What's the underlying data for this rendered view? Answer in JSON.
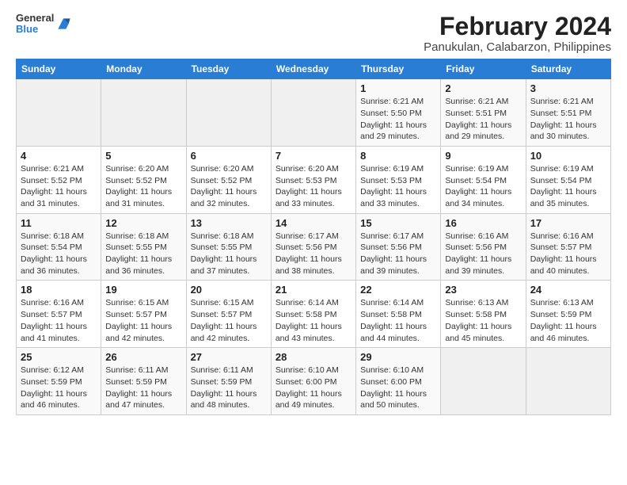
{
  "header": {
    "logo_line1": "General",
    "logo_line2": "Blue",
    "title": "February 2024",
    "subtitle": "Panukulan, Calabarzon, Philippines"
  },
  "weekdays": [
    "Sunday",
    "Monday",
    "Tuesday",
    "Wednesday",
    "Thursday",
    "Friday",
    "Saturday"
  ],
  "weeks": [
    [
      {
        "day": "",
        "info": ""
      },
      {
        "day": "",
        "info": ""
      },
      {
        "day": "",
        "info": ""
      },
      {
        "day": "",
        "info": ""
      },
      {
        "day": "1",
        "info": "Sunrise: 6:21 AM\nSunset: 5:50 PM\nDaylight: 11 hours and 29 minutes."
      },
      {
        "day": "2",
        "info": "Sunrise: 6:21 AM\nSunset: 5:51 PM\nDaylight: 11 hours and 29 minutes."
      },
      {
        "day": "3",
        "info": "Sunrise: 6:21 AM\nSunset: 5:51 PM\nDaylight: 11 hours and 30 minutes."
      }
    ],
    [
      {
        "day": "4",
        "info": "Sunrise: 6:21 AM\nSunset: 5:52 PM\nDaylight: 11 hours and 31 minutes."
      },
      {
        "day": "5",
        "info": "Sunrise: 6:20 AM\nSunset: 5:52 PM\nDaylight: 11 hours and 31 minutes."
      },
      {
        "day": "6",
        "info": "Sunrise: 6:20 AM\nSunset: 5:52 PM\nDaylight: 11 hours and 32 minutes."
      },
      {
        "day": "7",
        "info": "Sunrise: 6:20 AM\nSunset: 5:53 PM\nDaylight: 11 hours and 33 minutes."
      },
      {
        "day": "8",
        "info": "Sunrise: 6:19 AM\nSunset: 5:53 PM\nDaylight: 11 hours and 33 minutes."
      },
      {
        "day": "9",
        "info": "Sunrise: 6:19 AM\nSunset: 5:54 PM\nDaylight: 11 hours and 34 minutes."
      },
      {
        "day": "10",
        "info": "Sunrise: 6:19 AM\nSunset: 5:54 PM\nDaylight: 11 hours and 35 minutes."
      }
    ],
    [
      {
        "day": "11",
        "info": "Sunrise: 6:18 AM\nSunset: 5:54 PM\nDaylight: 11 hours and 36 minutes."
      },
      {
        "day": "12",
        "info": "Sunrise: 6:18 AM\nSunset: 5:55 PM\nDaylight: 11 hours and 36 minutes."
      },
      {
        "day": "13",
        "info": "Sunrise: 6:18 AM\nSunset: 5:55 PM\nDaylight: 11 hours and 37 minutes."
      },
      {
        "day": "14",
        "info": "Sunrise: 6:17 AM\nSunset: 5:56 PM\nDaylight: 11 hours and 38 minutes."
      },
      {
        "day": "15",
        "info": "Sunrise: 6:17 AM\nSunset: 5:56 PM\nDaylight: 11 hours and 39 minutes."
      },
      {
        "day": "16",
        "info": "Sunrise: 6:16 AM\nSunset: 5:56 PM\nDaylight: 11 hours and 39 minutes."
      },
      {
        "day": "17",
        "info": "Sunrise: 6:16 AM\nSunset: 5:57 PM\nDaylight: 11 hours and 40 minutes."
      }
    ],
    [
      {
        "day": "18",
        "info": "Sunrise: 6:16 AM\nSunset: 5:57 PM\nDaylight: 11 hours and 41 minutes."
      },
      {
        "day": "19",
        "info": "Sunrise: 6:15 AM\nSunset: 5:57 PM\nDaylight: 11 hours and 42 minutes."
      },
      {
        "day": "20",
        "info": "Sunrise: 6:15 AM\nSunset: 5:57 PM\nDaylight: 11 hours and 42 minutes."
      },
      {
        "day": "21",
        "info": "Sunrise: 6:14 AM\nSunset: 5:58 PM\nDaylight: 11 hours and 43 minutes."
      },
      {
        "day": "22",
        "info": "Sunrise: 6:14 AM\nSunset: 5:58 PM\nDaylight: 11 hours and 44 minutes."
      },
      {
        "day": "23",
        "info": "Sunrise: 6:13 AM\nSunset: 5:58 PM\nDaylight: 11 hours and 45 minutes."
      },
      {
        "day": "24",
        "info": "Sunrise: 6:13 AM\nSunset: 5:59 PM\nDaylight: 11 hours and 46 minutes."
      }
    ],
    [
      {
        "day": "25",
        "info": "Sunrise: 6:12 AM\nSunset: 5:59 PM\nDaylight: 11 hours and 46 minutes."
      },
      {
        "day": "26",
        "info": "Sunrise: 6:11 AM\nSunset: 5:59 PM\nDaylight: 11 hours and 47 minutes."
      },
      {
        "day": "27",
        "info": "Sunrise: 6:11 AM\nSunset: 5:59 PM\nDaylight: 11 hours and 48 minutes."
      },
      {
        "day": "28",
        "info": "Sunrise: 6:10 AM\nSunset: 6:00 PM\nDaylight: 11 hours and 49 minutes."
      },
      {
        "day": "29",
        "info": "Sunrise: 6:10 AM\nSunset: 6:00 PM\nDaylight: 11 hours and 50 minutes."
      },
      {
        "day": "",
        "info": ""
      },
      {
        "day": "",
        "info": ""
      }
    ]
  ]
}
